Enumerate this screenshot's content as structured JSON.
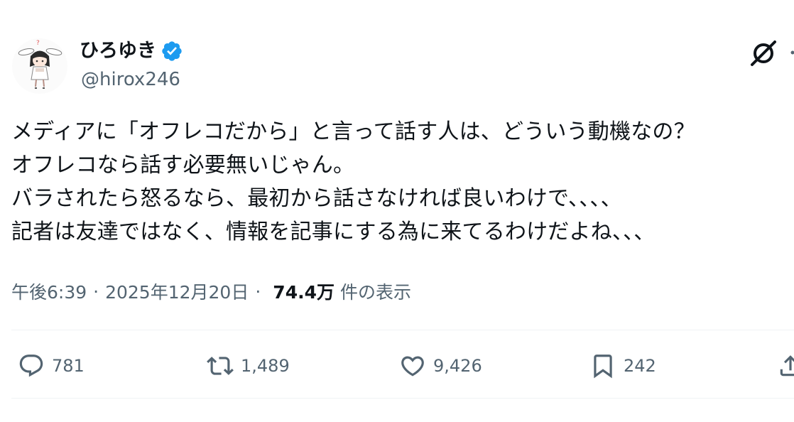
{
  "user": {
    "display_name": "ひろゆき",
    "handle": "@hirox246",
    "verified_icon": "verified-badge-icon",
    "verified_color": "#1d9bf0"
  },
  "tweet": {
    "lines": [
      "メディアに「オフレコだから」と言って話す人は、どういう動機なの？",
      "オフレコなら話す必要無いじゃん。",
      "バラされたら怒るなら、最初から話さなければ良いわけで、、、、",
      "記者は友達ではなく、情報を記事にする為に来てるわけだよね、、、"
    ]
  },
  "meta": {
    "time": "午後6:39",
    "separator": "·",
    "date": "2025年12月20日",
    "views_count": "74.4万",
    "views_label": "件の表示"
  },
  "actions": {
    "reply": {
      "icon": "reply-icon",
      "count": "781"
    },
    "retweet": {
      "icon": "retweet-icon",
      "count": "1,489"
    },
    "like": {
      "icon": "heart-icon",
      "count": "9,426"
    },
    "bookmark": {
      "icon": "bookmark-icon",
      "count": "242"
    },
    "share": {
      "icon": "share-icon"
    }
  },
  "header": {
    "grok_icon": "grok-icon"
  },
  "colors": {
    "text_primary": "#0f1419",
    "text_secondary": "#536471",
    "divider": "#eff3f4",
    "verified": "#1d9bf0"
  }
}
